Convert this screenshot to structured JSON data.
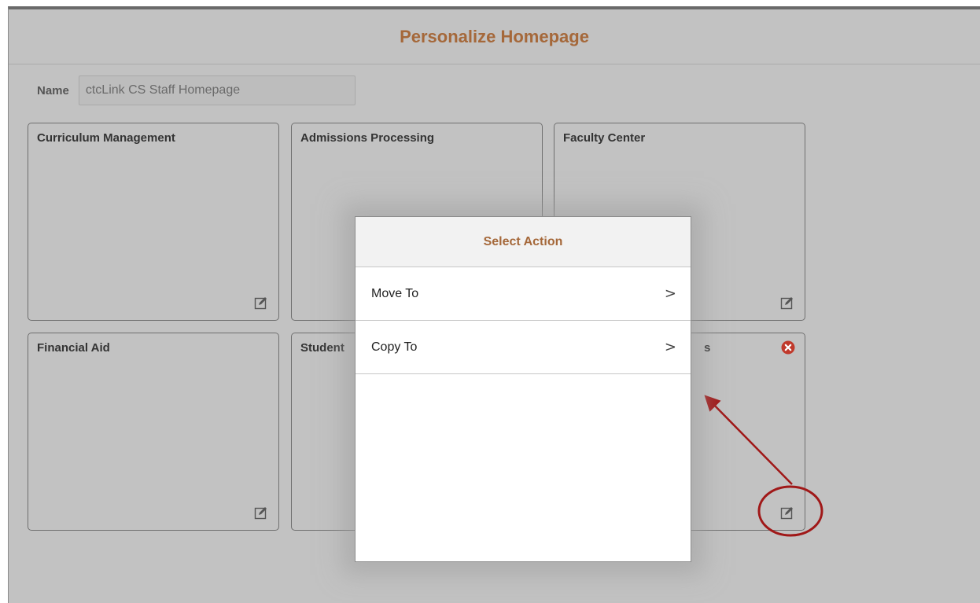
{
  "page": {
    "title": "Personalize Homepage"
  },
  "name_field": {
    "label": "Name",
    "value": "ctcLink CS Staff Homepage"
  },
  "tiles": [
    {
      "title": "Curriculum Management"
    },
    {
      "title": "Admissions Processing"
    },
    {
      "title": "Faculty Center"
    },
    {
      "title": "Financial Aid"
    },
    {
      "title": "Student"
    },
    {
      "title": "s"
    }
  ],
  "modal": {
    "title": "Select Action",
    "items": [
      {
        "label": "Move To",
        "chevron": ">"
      },
      {
        "label": "Copy To",
        "chevron": ">"
      }
    ]
  },
  "icons": {
    "edit": "edit-icon",
    "remove": "remove-icon"
  },
  "colors": {
    "title": "#a5683a",
    "annotation": "#a01818",
    "remove": "#c0392b"
  }
}
